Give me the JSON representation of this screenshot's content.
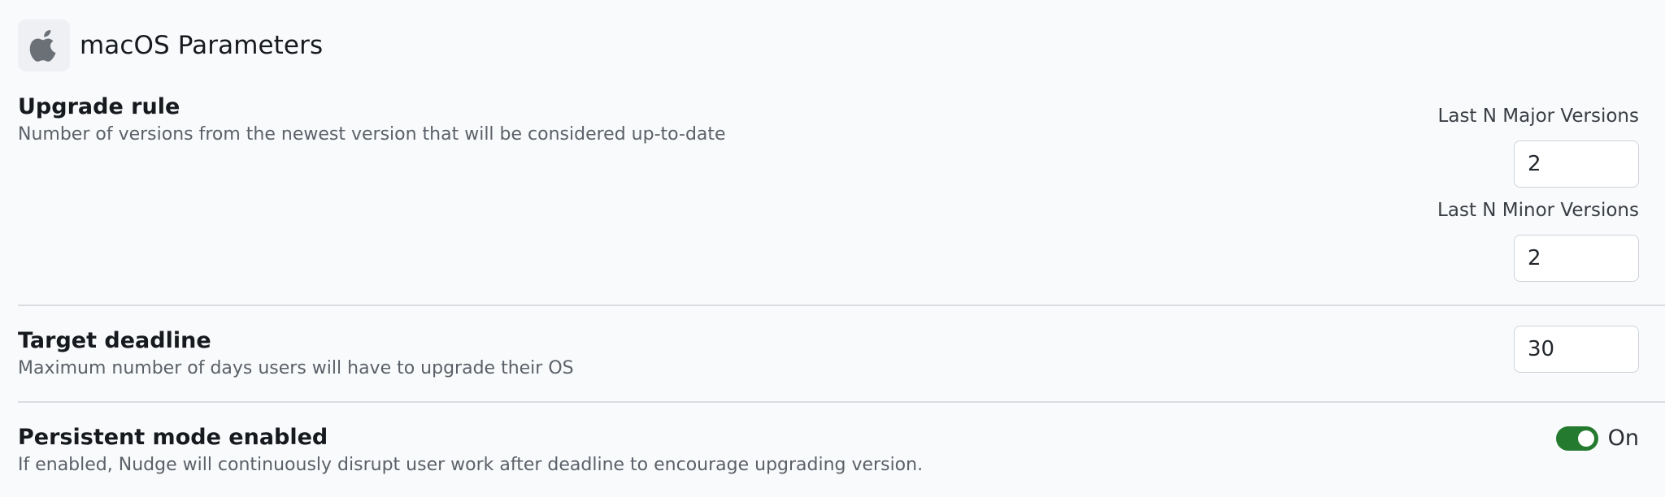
{
  "header": {
    "icon": "apple-logo-icon",
    "title": "macOS Parameters"
  },
  "upgrade_rule": {
    "title": "Upgrade rule",
    "description": "Number of versions from the newest version that will be considered up-to-date",
    "major": {
      "label": "Last N Major Versions",
      "value": "2"
    },
    "minor": {
      "label": "Last N Minor Versions",
      "value": "2"
    }
  },
  "target_deadline": {
    "title": "Target deadline",
    "description": "Maximum number of days users will have to upgrade their OS",
    "value": "30"
  },
  "persistent_mode": {
    "title": "Persistent mode enabled",
    "description": "If enabled, Nudge will continuously disrupt user work after deadline to encourage upgrading version.",
    "toggle_state": "On",
    "enabled": true
  },
  "colors": {
    "background": "#f9fafc",
    "toggle_on": "#247a2e",
    "divider": "#d9dde2"
  }
}
